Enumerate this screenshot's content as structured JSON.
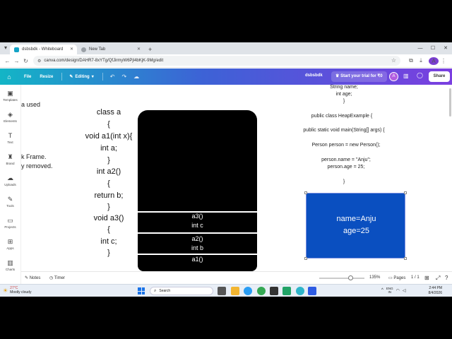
{
  "browser": {
    "tabs": [
      {
        "title": "dsbsbdk - Whiteboard",
        "active": true,
        "favicon_color": "#13a3c6"
      },
      {
        "title": "New Tab",
        "active": false,
        "favicon_color": "#777777"
      }
    ],
    "url": "canva.com/design/DAHR7-8xYTg/QfJirmyW6Pjl4bKjK-9Mg/edit",
    "profile_initial": "A"
  },
  "toolbar": {
    "file": "File",
    "resize": "Resize",
    "editing": "Editing",
    "title": "dsbsbdk",
    "trial": "Start your trial for ₹0",
    "avatar_initial": "A",
    "share": "Share"
  },
  "rail": [
    {
      "label": "Templates",
      "icon": "templates-icon"
    },
    {
      "label": "Elements",
      "icon": "elements-icon"
    },
    {
      "label": "Text",
      "icon": "text-icon"
    },
    {
      "label": "Brand",
      "icon": "brand-icon"
    },
    {
      "label": "Uploads",
      "icon": "uploads-icon"
    },
    {
      "label": "Tools",
      "icon": "tools-icon"
    },
    {
      "label": "Projects",
      "icon": "projects-icon"
    },
    {
      "label": "Apps",
      "icon": "apps-icon"
    },
    {
      "label": "Charts",
      "icon": "charts-icon"
    }
  ],
  "canvas": {
    "left_notes": [
      "a used",
      "k Frame.",
      "y removed."
    ],
    "code": [
      "class a",
      "{",
      "void a1(int x){",
      "int a;",
      "}",
      "int a2()",
      "{",
      "return  b;",
      "}",
      "void a3()",
      "{",
      "int c;",
      "}"
    ],
    "stack_frames": [
      {
        "name": "a3()",
        "var": "int c"
      },
      {
        "name": "a2()",
        "var": "int b"
      },
      {
        "name": "a1()",
        "var": ""
      }
    ],
    "right_code": [
      "String name;",
      "int age;",
      "}",
      "public class HeapExample {",
      "public static void main(String[] args) {",
      "Person person = new Person();",
      "person.name = \"Anju\";",
      "person.age = 25;",
      "}"
    ],
    "heap": {
      "line1": "name=Anju",
      "line2": "age=25",
      "color": "#0a4fc0"
    }
  },
  "bottom": {
    "notes": "Notes",
    "timer": "Timer",
    "zoom": "135%",
    "zoom_fraction": 0.7,
    "pages": "Pages",
    "page_count": "1 / 1"
  },
  "taskbar": {
    "temp": "27°C",
    "weather": "Mostly cloudy",
    "search": "Search",
    "lang": "ENG",
    "region": "IN",
    "time": "2:44 PM",
    "date": "8/4/2026"
  }
}
